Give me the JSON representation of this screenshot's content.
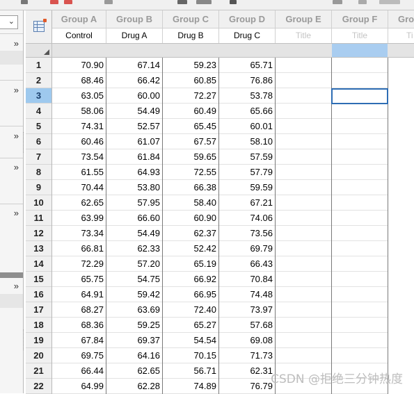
{
  "columns": [
    {
      "group": "Group A",
      "title": "Control"
    },
    {
      "group": "Group B",
      "title": "Drug A"
    },
    {
      "group": "Group C",
      "title": "Drug B"
    },
    {
      "group": "Group D",
      "title": "Drug C"
    },
    {
      "group": "Group E",
      "title": "Title"
    },
    {
      "group": "Group F",
      "title": "Title"
    },
    {
      "group": "Gro",
      "title": "Ti"
    }
  ],
  "row_numbers": [
    "1",
    "2",
    "3",
    "4",
    "5",
    "6",
    "7",
    "8",
    "9",
    "10",
    "11",
    "12",
    "13",
    "14",
    "15",
    "16",
    "17",
    "18",
    "19",
    "20",
    "21",
    "22"
  ],
  "rows": [
    [
      "70.90",
      "67.14",
      "59.23",
      "65.71"
    ],
    [
      "68.46",
      "66.42",
      "60.85",
      "76.86"
    ],
    [
      "63.05",
      "60.00",
      "72.27",
      "53.78"
    ],
    [
      "58.06",
      "54.49",
      "60.49",
      "65.66"
    ],
    [
      "74.31",
      "52.57",
      "65.45",
      "60.01"
    ],
    [
      "60.46",
      "61.07",
      "67.57",
      "58.10"
    ],
    [
      "73.54",
      "61.84",
      "59.65",
      "57.59"
    ],
    [
      "61.55",
      "64.93",
      "72.55",
      "57.79"
    ],
    [
      "70.44",
      "53.80",
      "66.38",
      "59.59"
    ],
    [
      "62.65",
      "57.95",
      "58.40",
      "67.21"
    ],
    [
      "63.99",
      "66.60",
      "60.90",
      "74.06"
    ],
    [
      "73.34",
      "54.49",
      "62.37",
      "73.56"
    ],
    [
      "66.81",
      "62.33",
      "52.42",
      "69.79"
    ],
    [
      "72.29",
      "57.20",
      "65.19",
      "66.43"
    ],
    [
      "65.75",
      "54.75",
      "66.92",
      "70.84"
    ],
    [
      "64.91",
      "59.42",
      "66.95",
      "74.48"
    ],
    [
      "68.27",
      "63.69",
      "72.40",
      "73.97"
    ],
    [
      "68.36",
      "59.25",
      "65.27",
      "57.68"
    ],
    [
      "67.84",
      "69.37",
      "54.54",
      "69.08"
    ],
    [
      "69.75",
      "64.16",
      "70.15",
      "71.73"
    ],
    [
      "66.44",
      "62.65",
      "56.71",
      "62.31"
    ],
    [
      "64.99",
      "62.28",
      "74.89",
      "76.79"
    ]
  ],
  "selected_row": "3",
  "left_panel": {
    "expand_glyph": "»",
    "dropdown_glyph": "⌄"
  },
  "watermark": "CSDN @拒绝三分钟热度",
  "colors": {
    "selection_fill": "#a9cdf0",
    "selection_border": "#2e6db4",
    "row_header_selected": "#9ec9ee"
  }
}
